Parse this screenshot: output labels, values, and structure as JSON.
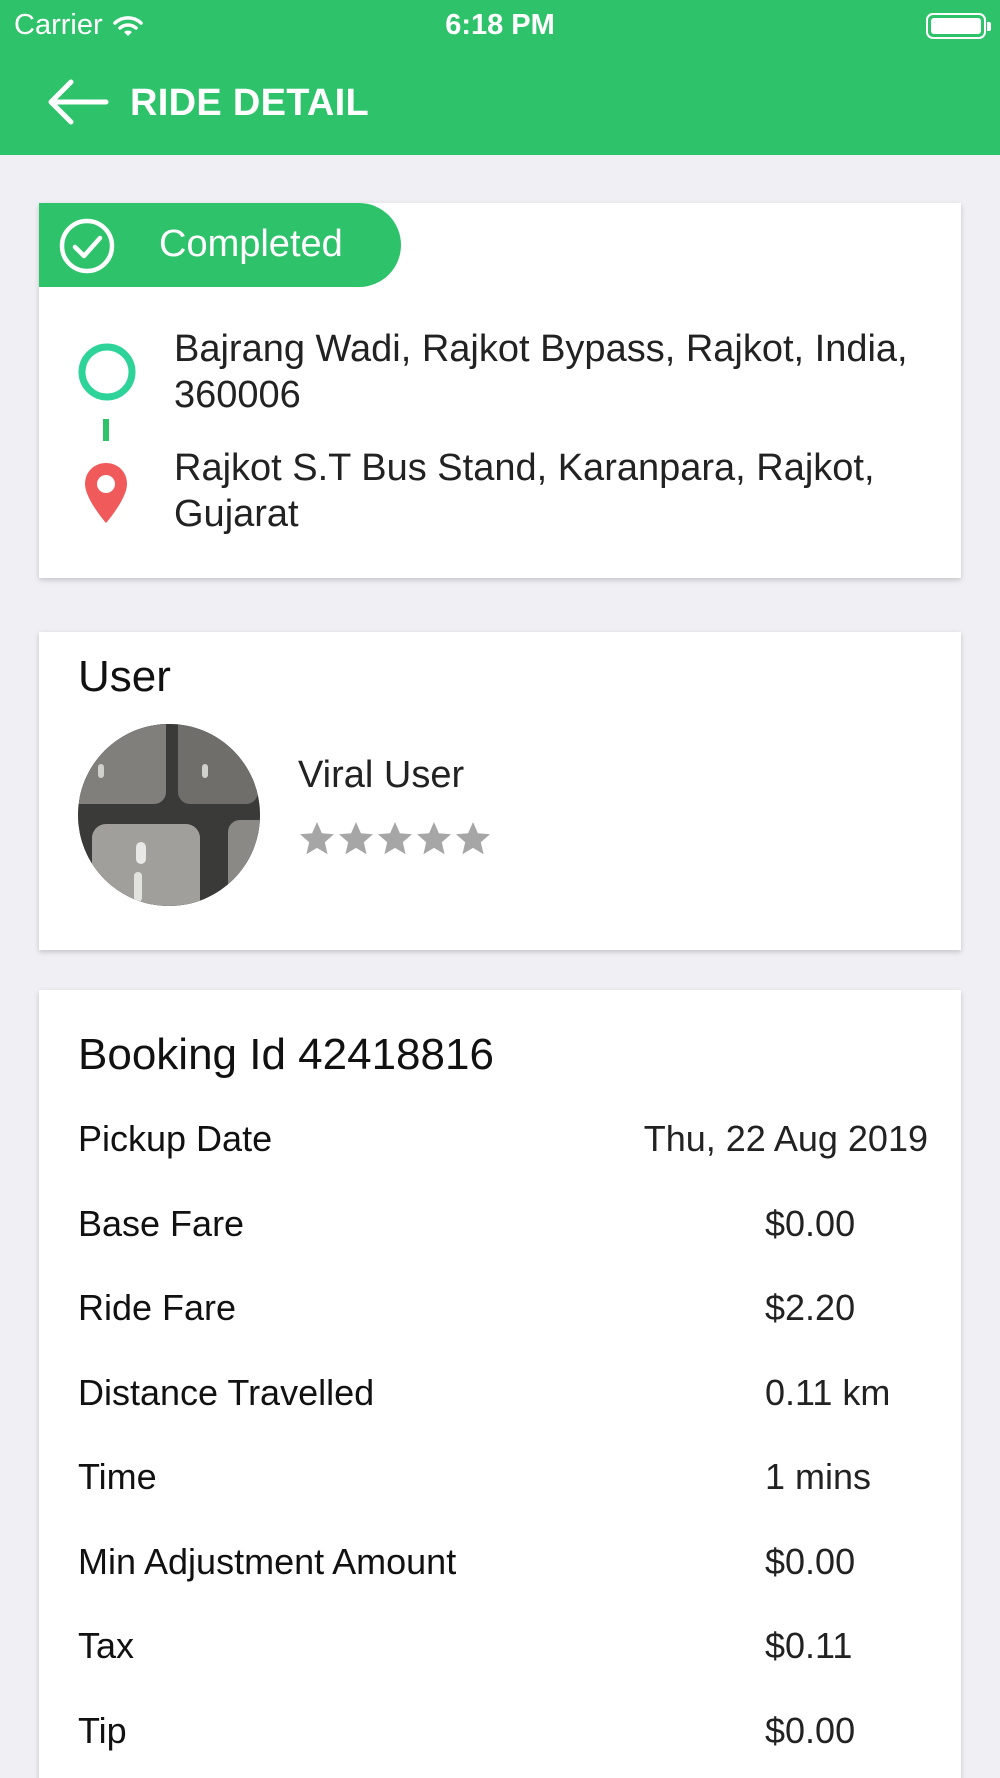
{
  "status_bar": {
    "carrier": "Carrier",
    "time": "6:18 PM"
  },
  "header": {
    "title": "RIDE DETAIL"
  },
  "ride": {
    "status": "Completed",
    "pickup_address": "Bajrang Wadi, Rajkot Bypass, Rajkot, India, 360006",
    "drop_address": "Rajkot S.T Bus Stand, Karanpara, Rajkot, Gujarat"
  },
  "user": {
    "section_title": "User",
    "name": "Viral User",
    "rating": 0,
    "rating_max": 5
  },
  "booking": {
    "id_text": "Booking Id 42418816",
    "rows": [
      {
        "label": "Pickup Date",
        "value": "Thu, 22 Aug 2019"
      },
      {
        "label": "Base Fare",
        "value": "$0.00"
      },
      {
        "label": "Ride Fare",
        "value": "$2.20"
      },
      {
        "label": "Distance Travelled",
        "value": "0.11 km"
      },
      {
        "label": "Time",
        "value": "1 mins"
      },
      {
        "label": "Min Adjustment Amount",
        "value": "$0.00"
      },
      {
        "label": "Tax",
        "value": "$0.11"
      },
      {
        "label": "Tip",
        "value": "$0.00"
      }
    ]
  },
  "colors": {
    "brand_green": "#2ec36b",
    "pickup_teal": "#2ed39a",
    "drop_red": "#f05a5a",
    "star_gray": "#a6a6a6"
  }
}
